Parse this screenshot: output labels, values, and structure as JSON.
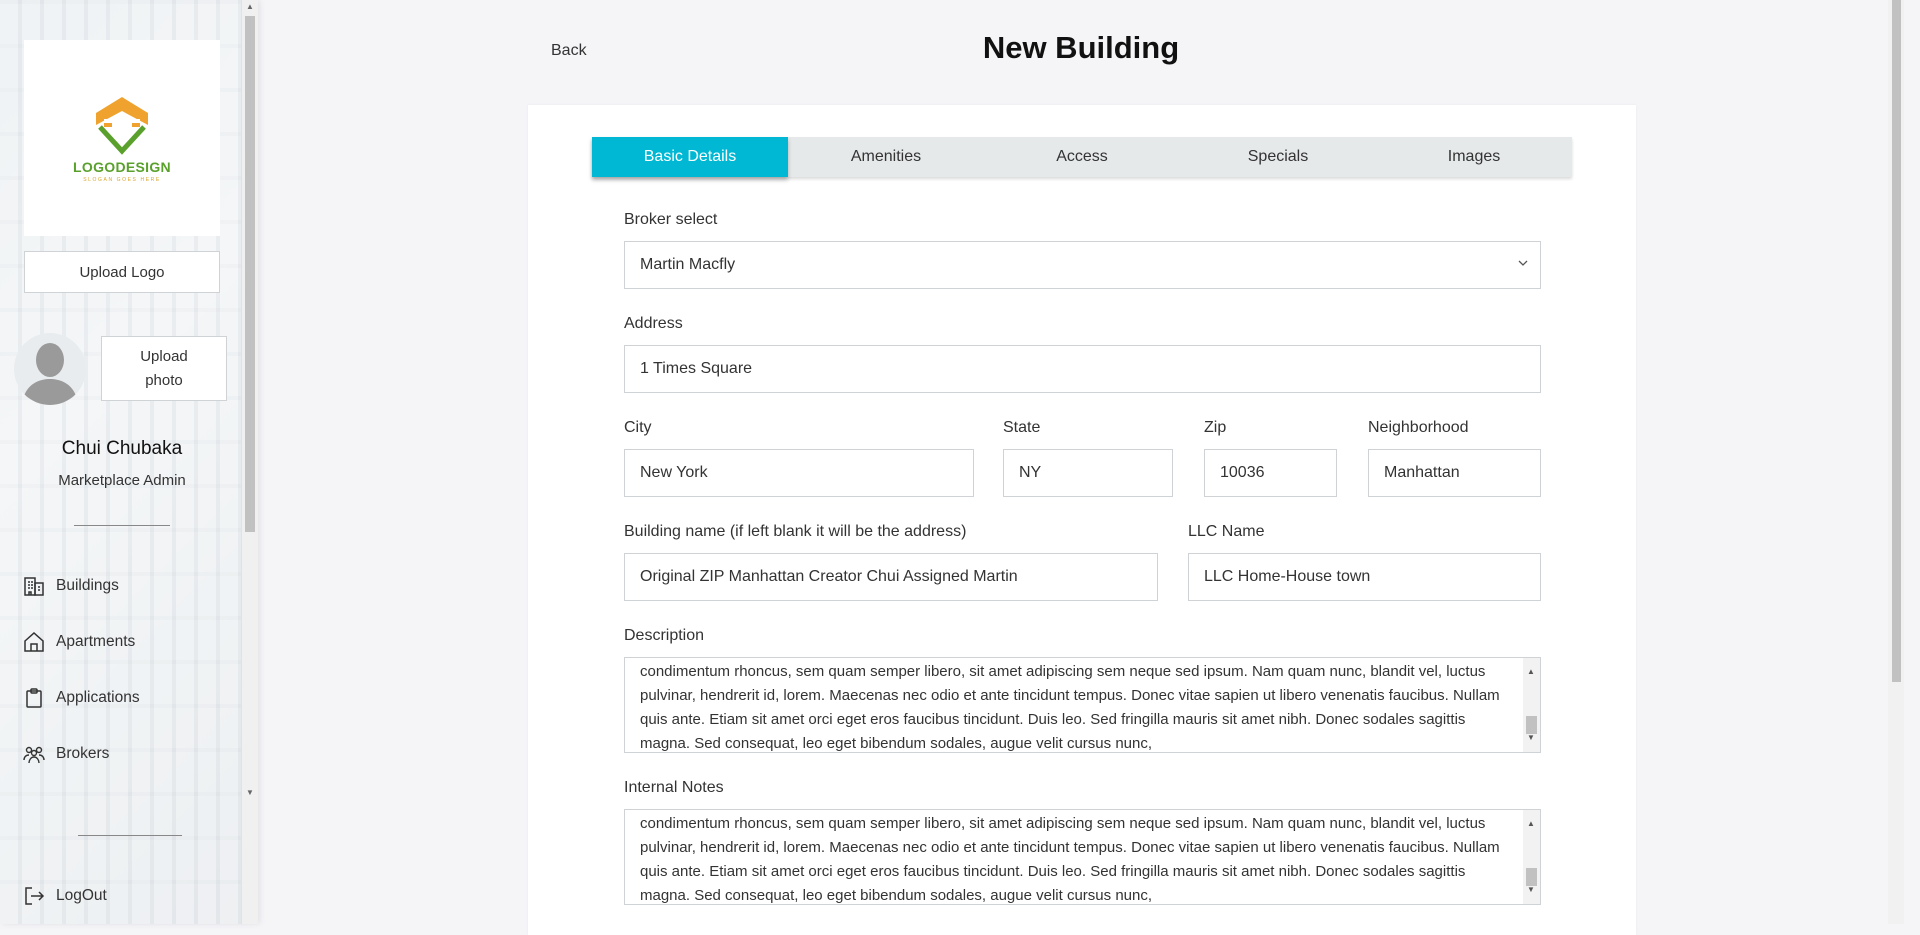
{
  "sidebar": {
    "logo": {
      "text": "LOGODESIGN",
      "subtext": "SLOGAN GOES HERE"
    },
    "upload_logo_label": "Upload Logo",
    "upload_photo_label": "Upload photo",
    "user": {
      "name": "Chui Chubaka",
      "role": "Marketplace Admin"
    },
    "nav": [
      {
        "label": "Buildings",
        "icon": "building-icon"
      },
      {
        "label": "Apartments",
        "icon": "home-icon"
      },
      {
        "label": "Applications",
        "icon": "clipboard-icon"
      },
      {
        "label": "Brokers",
        "icon": "people-icon"
      }
    ],
    "logout_label": "LogOut"
  },
  "header": {
    "back_label": "Back",
    "title": "New Building"
  },
  "tabs": [
    {
      "label": "Basic Details",
      "active": true
    },
    {
      "label": "Amenities",
      "active": false
    },
    {
      "label": "Access",
      "active": false
    },
    {
      "label": "Specials",
      "active": false
    },
    {
      "label": "Images",
      "active": false
    }
  ],
  "form": {
    "broker": {
      "label": "Broker select",
      "value": "Martin Macfly"
    },
    "address": {
      "label": "Address",
      "value": "1 Times Square"
    },
    "city": {
      "label": "City",
      "value": "New York"
    },
    "state": {
      "label": "State",
      "value": "NY"
    },
    "zip": {
      "label": "Zip",
      "value": "10036"
    },
    "neighborhood": {
      "label": "Neighborhood",
      "value": "Manhattan"
    },
    "building_name": {
      "label": "Building name (if left blank it will be the address)",
      "value": "Original ZIP Manhattan Creator Chui Assigned Martin"
    },
    "llc_name": {
      "label": "LLC Name",
      "value": "LLC Home-House town"
    },
    "description": {
      "label": "Description",
      "value": "condimentum rhoncus, sem quam semper libero, sit amet adipiscing sem neque sed ipsum. Nam quam nunc, blandit vel, luctus pulvinar, hendrerit id, lorem. Maecenas nec odio et ante tincidunt tempus. Donec vitae sapien ut libero venenatis faucibus. Nullam quis ante. Etiam sit amet orci eget eros faucibus tincidunt. Duis leo. Sed fringilla mauris sit amet nibh. Donec sodales sagittis magna. Sed consequat, leo eget bibendum sodales, augue velit cursus nunc,"
    },
    "internal_notes": {
      "label": "Internal Notes",
      "value": "condimentum rhoncus, sem quam semper libero, sit amet adipiscing sem neque sed ipsum. Nam quam nunc, blandit vel, luctus pulvinar, hendrerit id, lorem. Maecenas nec odio et ante tincidunt tempus. Donec vitae sapien ut libero venenatis faucibus. Nullam quis ante. Etiam sit amet orci eget eros faucibus tincidunt. Duis leo. Sed fringilla mauris sit amet nibh. Donec sodales sagittis magna. Sed consequat, leo eget bibendum sodales, augue velit cursus nunc,"
    }
  },
  "colors": {
    "accent": "#00b8d4",
    "logo_orange": "#f0a22e",
    "logo_green": "#5aa02c"
  }
}
